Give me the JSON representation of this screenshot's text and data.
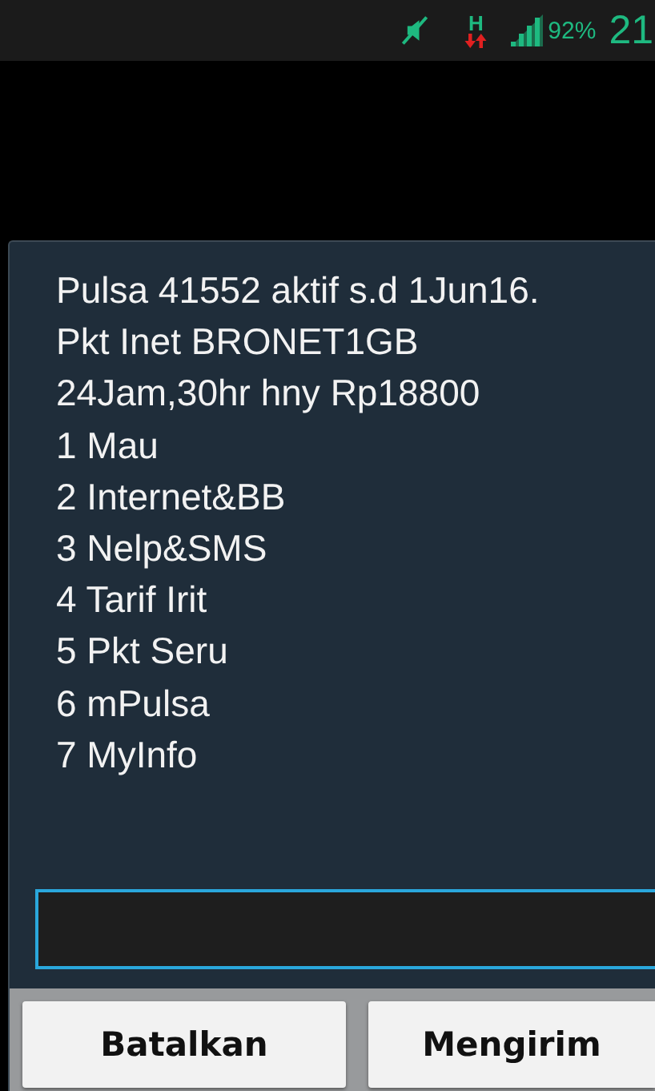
{
  "status_bar": {
    "network_type": "H",
    "battery": "92%",
    "time": "21"
  },
  "dialog": {
    "message_lines": [
      "Pulsa 41552 aktif s.d 1Jun16.",
      "Pkt Inet BRONET1GB",
      "24Jam,30hr hny Rp18800",
      "1 Mau",
      "2 Internet&BB",
      "3 Nelp&SMS",
      "4 Tarif Irit",
      "5 Pkt Seru",
      "6 mPulsa",
      "7 MyInfo"
    ],
    "buttons": [
      {
        "label": "Batalkan"
      },
      {
        "label": "Mengirim"
      }
    ]
  }
}
